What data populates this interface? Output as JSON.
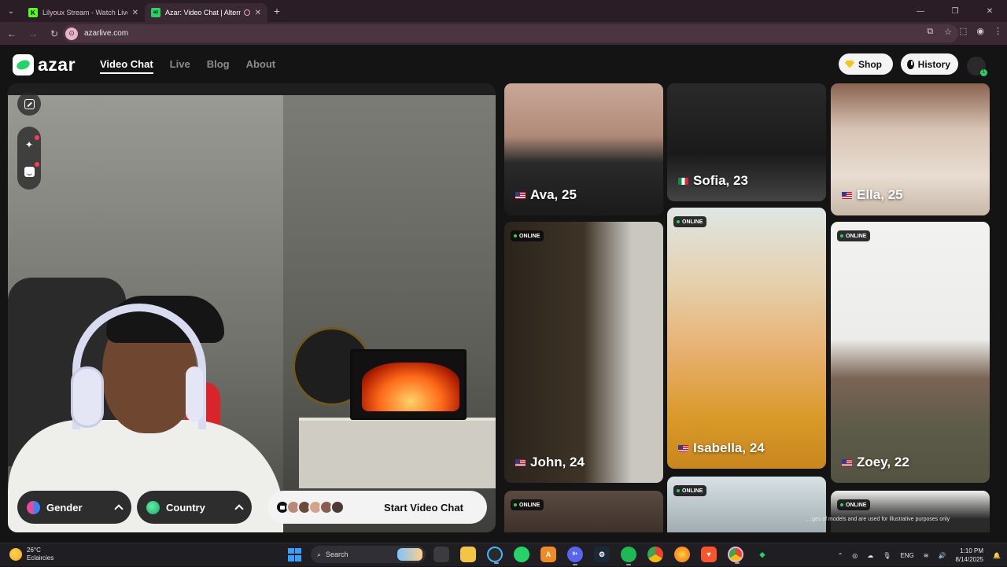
{
  "browser": {
    "tabs": [
      {
        "title": "Lilyoux Stream - Watch Live on",
        "favicon": "K",
        "close": "✕"
      },
      {
        "title": "Azar: Video Chat | Alternativ",
        "favicon": "az",
        "close": "✕"
      }
    ],
    "new_tab": "+",
    "window_controls": [
      "—",
      "❐",
      "✕"
    ],
    "url": "azarlive.com"
  },
  "header": {
    "brand": "azar",
    "nav": [
      "Video Chat",
      "Live",
      "Blog",
      "About"
    ],
    "active_nav": "Video Chat",
    "shop_label": "Shop",
    "history_label": "History",
    "avatar_badge": "1"
  },
  "video_panel": {
    "gender_label": "Gender",
    "country_label": "Country",
    "start_label": "Start Video Chat"
  },
  "gallery": {
    "online_label": "ONLINE",
    "profiles": [
      {
        "name": "Ava, 25",
        "flag": "us"
      },
      {
        "name": "Sofia, 23",
        "flag": "it"
      },
      {
        "name": "Ella, 25",
        "flag": "us"
      },
      {
        "name": "John, 24",
        "flag": "us",
        "online": true
      },
      {
        "name": "Isabella, 24",
        "flag": "us",
        "online": true
      },
      {
        "name": "Zoey, 22",
        "flag": "us",
        "online": true
      }
    ],
    "disclaimer": "…ges of models and are used for illustrative purposes only"
  },
  "taskbar": {
    "temperature": "26°C",
    "weather": "Eclaircies",
    "search_placeholder": "Search",
    "language": "ENG",
    "time": "1:10 PM",
    "date": "8/14/2025",
    "discord_badge": "9+"
  },
  "colors": {
    "accent_green": "#25d366",
    "chrome_bg": "#2b1d26",
    "page_bg": "#141414"
  }
}
